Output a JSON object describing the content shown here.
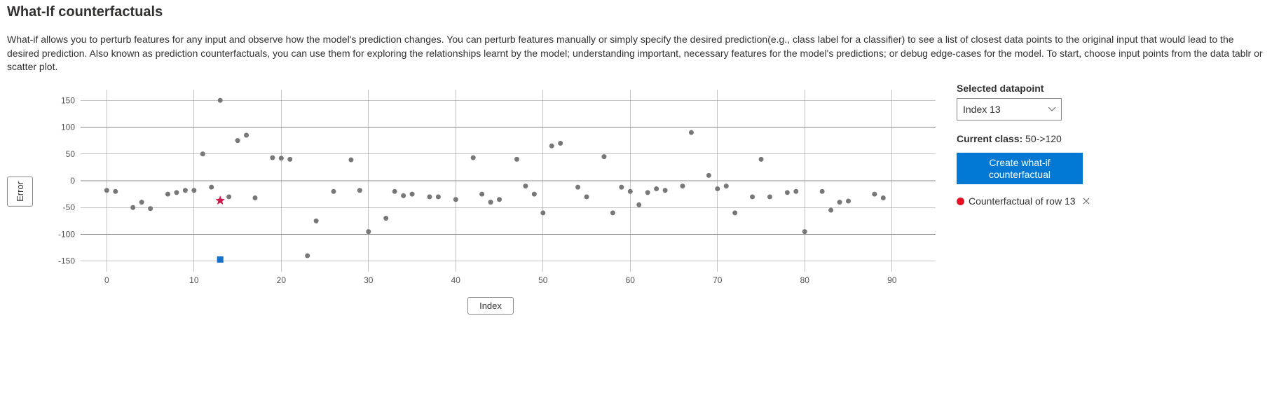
{
  "title": "What-If counterfactuals",
  "description": "What-if allows you to perturb features for any input and observe how the model's prediction changes. You can perturb features manually or simply specify the desired prediction(e.g., class label for a classifier) to see a list of closest data points to the original input that would lead to the desired prediction. Also known as prediction counterfactuals, you can use them for exploring the relationships learnt by the model; understanding important, necessary features for the model's predictions; or debug edge-cases for the model. To start, choose input points from the data tablr or scatter plot.",
  "side": {
    "selected_label": "Selected datapoint",
    "selected_value": "Index 13",
    "current_class_label": "Current class:",
    "current_class_value": "50->120",
    "button_line1": "Create what-if",
    "button_line2": "counterfactual",
    "legend_label": "Counterfactual of row 13"
  },
  "axes": {
    "xlabel": "Index",
    "ylabel": "Error"
  },
  "chart_data": {
    "type": "scatter",
    "xlabel": "Index",
    "ylabel": "Error",
    "xlim": [
      -3,
      95
    ],
    "ylim": [
      -170,
      170
    ],
    "xticks": [
      0,
      10,
      20,
      30,
      40,
      50,
      60,
      70,
      80,
      90
    ],
    "yticks": [
      -150,
      -100,
      -50,
      0,
      50,
      100,
      150
    ],
    "selected": {
      "x": 13,
      "y": -37,
      "marker": "star",
      "color": "#d1194d"
    },
    "counterfactual": {
      "x": 13,
      "y": -147,
      "marker": "square",
      "color": "#1a6fc9"
    },
    "series": [
      {
        "name": "data",
        "color": "#777",
        "points": [
          {
            "x": 0,
            "y": -18
          },
          {
            "x": 1,
            "y": -20
          },
          {
            "x": 3,
            "y": -50
          },
          {
            "x": 4,
            "y": -40
          },
          {
            "x": 5,
            "y": -52
          },
          {
            "x": 7,
            "y": -25
          },
          {
            "x": 8,
            "y": -22
          },
          {
            "x": 9,
            "y": -18
          },
          {
            "x": 10,
            "y": -18
          },
          {
            "x": 11,
            "y": 50
          },
          {
            "x": 12,
            "y": -12
          },
          {
            "x": 13,
            "y": 150
          },
          {
            "x": 14,
            "y": -30
          },
          {
            "x": 15,
            "y": 75
          },
          {
            "x": 16,
            "y": 85
          },
          {
            "x": 17,
            "y": -32
          },
          {
            "x": 19,
            "y": 43
          },
          {
            "x": 20,
            "y": 42
          },
          {
            "x": 21,
            "y": 40
          },
          {
            "x": 23,
            "y": -140
          },
          {
            "x": 24,
            "y": -75
          },
          {
            "x": 26,
            "y": -20
          },
          {
            "x": 28,
            "y": 39
          },
          {
            "x": 29,
            "y": -18
          },
          {
            "x": 30,
            "y": -95
          },
          {
            "x": 32,
            "y": -70
          },
          {
            "x": 33,
            "y": -20
          },
          {
            "x": 34,
            "y": -28
          },
          {
            "x": 35,
            "y": -25
          },
          {
            "x": 37,
            "y": -30
          },
          {
            "x": 38,
            "y": -30
          },
          {
            "x": 40,
            "y": -35
          },
          {
            "x": 42,
            "y": 43
          },
          {
            "x": 43,
            "y": -25
          },
          {
            "x": 44,
            "y": -40
          },
          {
            "x": 45,
            "y": -35
          },
          {
            "x": 47,
            "y": 40
          },
          {
            "x": 48,
            "y": -10
          },
          {
            "x": 49,
            "y": -25
          },
          {
            "x": 50,
            "y": -60
          },
          {
            "x": 51,
            "y": 65
          },
          {
            "x": 52,
            "y": 70
          },
          {
            "x": 54,
            "y": -12
          },
          {
            "x": 55,
            "y": -30
          },
          {
            "x": 57,
            "y": 45
          },
          {
            "x": 58,
            "y": -60
          },
          {
            "x": 59,
            "y": -12
          },
          {
            "x": 60,
            "y": -20
          },
          {
            "x": 61,
            "y": -45
          },
          {
            "x": 62,
            "y": -22
          },
          {
            "x": 63,
            "y": -15
          },
          {
            "x": 64,
            "y": -18
          },
          {
            "x": 66,
            "y": -10
          },
          {
            "x": 67,
            "y": 90
          },
          {
            "x": 69,
            "y": 10
          },
          {
            "x": 70,
            "y": -15
          },
          {
            "x": 71,
            "y": -10
          },
          {
            "x": 72,
            "y": -60
          },
          {
            "x": 74,
            "y": -30
          },
          {
            "x": 75,
            "y": 40
          },
          {
            "x": 76,
            "y": -30
          },
          {
            "x": 78,
            "y": -22
          },
          {
            "x": 79,
            "y": -20
          },
          {
            "x": 80,
            "y": -95
          },
          {
            "x": 82,
            "y": -20
          },
          {
            "x": 83,
            "y": -55
          },
          {
            "x": 84,
            "y": -40
          },
          {
            "x": 85,
            "y": -38
          },
          {
            "x": 88,
            "y": -25
          },
          {
            "x": 89,
            "y": -32
          }
        ]
      }
    ]
  }
}
